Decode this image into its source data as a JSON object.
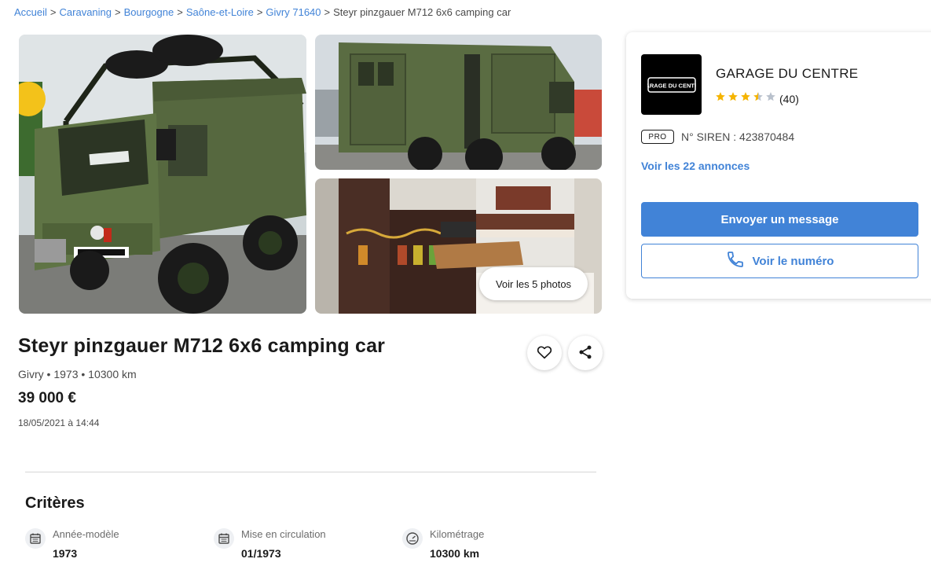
{
  "breadcrumb": {
    "items": [
      "Accueil",
      "Caravaning",
      "Bourgogne",
      "Saône-et-Loire",
      "Givry 71640"
    ],
    "current": "Steyr pinzgauer M712 6x6 camping car",
    "separator": ">"
  },
  "gallery": {
    "see_photos_label": "Voir les 5 photos"
  },
  "listing": {
    "title": "Steyr pinzgauer M712 6x6 camping car",
    "meta": "Givry • 1973 • 10300 km",
    "price": "39 000 €",
    "date": "18/05/2021 à 14:44"
  },
  "criteria": {
    "title": "Critères",
    "items": [
      {
        "label": "Année-modèle",
        "value": "1973",
        "icon": "calendar-icon"
      },
      {
        "label": "Mise en circulation",
        "value": "01/1973",
        "icon": "calendar-icon"
      },
      {
        "label": "Kilométrage",
        "value": "10300 km",
        "icon": "odometer-icon"
      }
    ]
  },
  "seller": {
    "name": "GARAGE DU CENTRE",
    "logo_text": "GARAGE DU CENTRE",
    "rating": 3.5,
    "rating_max": 5,
    "review_count": "(40)",
    "pro_badge": "PRO",
    "siren": "N° SIREN : 423870484",
    "see_ads_label": "Voir les 22 annonces",
    "message_button": "Envoyer un message",
    "phone_button": "Voir le numéro"
  },
  "colors": {
    "accent": "#4183d7",
    "star": "#f5b400",
    "star_empty": "#b9c1cc",
    "text": "#1a1a1a"
  }
}
